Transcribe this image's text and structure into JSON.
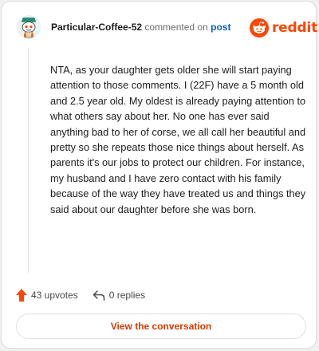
{
  "header": {
    "username": "Particular-Coffee-52",
    "commented_on": "commented on",
    "post_link": "post",
    "brand": "reddit"
  },
  "comment": {
    "body": "NTA, as your daughter gets older she will start paying attention to those comments. I (22F) have a 5 month old and 2.5 year old. My oldest is already paying attention to what others say about her. No one has ever said anything bad to her of corse, we all call her beautiful and pretty so she repeats those nice things about herself. As parents it's our jobs to protect our children. For instance, my husband and I have zero contact with his family because of the way they have treated us and things they said about our daughter before she was born."
  },
  "actions": {
    "upvotes": "43 upvotes",
    "replies": "0 replies"
  },
  "footer": {
    "view_button": "View the conversation"
  },
  "colors": {
    "brand_orange": "#ff4500",
    "link_blue": "#0b5fc6",
    "button_text": "#d93a00"
  },
  "icons": {
    "avatar": "snoo-avatar-icon",
    "logo": "reddit-alien-icon",
    "upvote": "upvote-arrow-icon",
    "reply": "reply-arrow-icon"
  }
}
